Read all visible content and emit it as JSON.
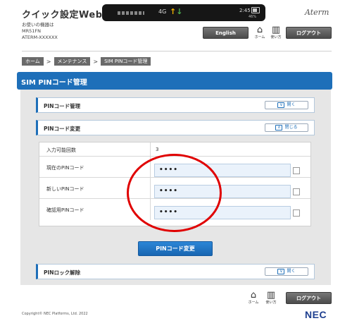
{
  "header": {
    "app_title": "クイック設定Web",
    "device_info_label": "お使いの機器は",
    "device_model": "MR51FN",
    "device_id": "ATERM-XXXXXX",
    "brand": "Aterm",
    "english_label": "English",
    "home_label": "ホーム",
    "help_label": "使い方",
    "logout_label": "ログアウト"
  },
  "status_bar": {
    "network_type": "4G",
    "up_arrow": "↑",
    "down_arrow": "↓",
    "clock": "2:45",
    "battery_percent": "46%"
  },
  "breadcrumb": {
    "items": [
      "ホーム",
      "メンテナンス",
      "SIM PINコード管理"
    ],
    "separator": ">"
  },
  "page": {
    "title": "SIM PINコード管理"
  },
  "sections": {
    "pin_management": {
      "title": "PINコード管理",
      "toggle_label": "開く"
    },
    "pin_change": {
      "title": "PINコード変更",
      "toggle_label": "閉じる"
    },
    "pin_unlock": {
      "title": "PINロック解除",
      "toggle_label": "開く"
    }
  },
  "pin_form": {
    "attempts_label": "入力可能回数",
    "attempts_value": "3",
    "current_pin_label": "現在のPINコード",
    "current_pin_value": "••••",
    "new_pin_label": "新しいPINコード",
    "new_pin_value": "••••",
    "confirm_pin_label": "確認用PINコード",
    "confirm_pin_value": "••••",
    "submit_label": "PINコード変更"
  },
  "footer": {
    "home_label": "ホーム",
    "help_label": "使い方",
    "logout_label": "ログアウト",
    "copyright": "Copyright© NEC Platforms, Ltd. 2022",
    "nec_logo": "NEC"
  },
  "colors": {
    "accent": "#1e6fb9",
    "highlight": "#e00000",
    "dark_button": "#555555"
  }
}
